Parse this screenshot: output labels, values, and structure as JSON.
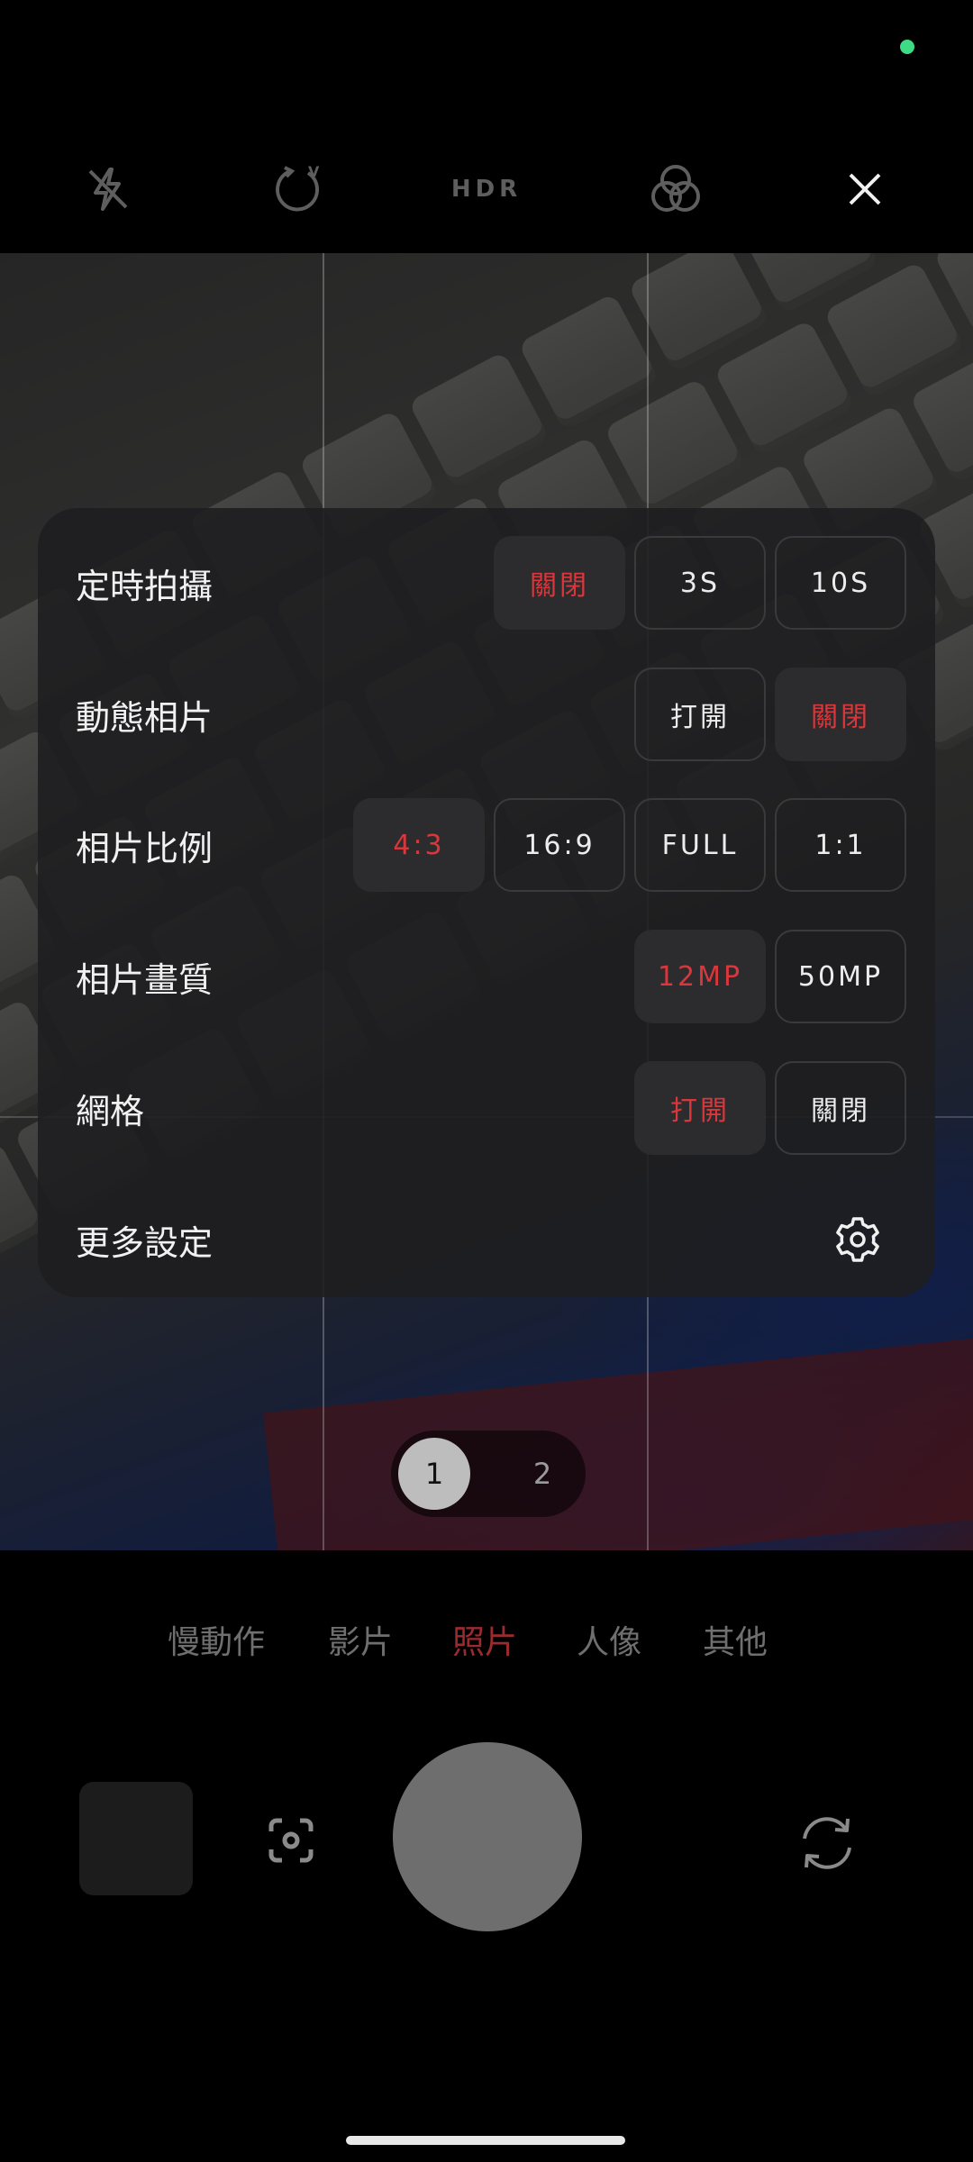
{
  "top_bar": {
    "icons": [
      "flash-off-icon",
      "motion-v-icon",
      "hdr-icon",
      "filter-icon",
      "close-icon"
    ],
    "hdr_label": "HDR",
    "motion_label": "V"
  },
  "settings": {
    "rows": [
      {
        "label": "定時拍攝",
        "options": [
          "關閉",
          "3S",
          "10S"
        ],
        "selected": "關閉"
      },
      {
        "label": "動態相片",
        "options": [
          "打開",
          "關閉"
        ],
        "selected": "關閉"
      },
      {
        "label": "相片比例",
        "options": [
          "4:3",
          "16:9",
          "FULL",
          "1:1"
        ],
        "selected": "4:3"
      },
      {
        "label": "相片畫質",
        "options": [
          "12MP",
          "50MP"
        ],
        "selected": "12MP"
      },
      {
        "label": "網格",
        "options": [
          "打開",
          "關閉"
        ],
        "selected": "打開"
      },
      {
        "label": "更多設定",
        "icon": "gear-icon"
      }
    ]
  },
  "zoom": {
    "options": [
      "1",
      "2"
    ],
    "selected": "1"
  },
  "modes": {
    "items": [
      "慢動作",
      "影片",
      "照片",
      "人像",
      "其他"
    ],
    "selected": "照片"
  },
  "colors": {
    "accent": "#d9373b",
    "mode_active": "#9c2b2e",
    "status_dot": "#3ddc84"
  }
}
